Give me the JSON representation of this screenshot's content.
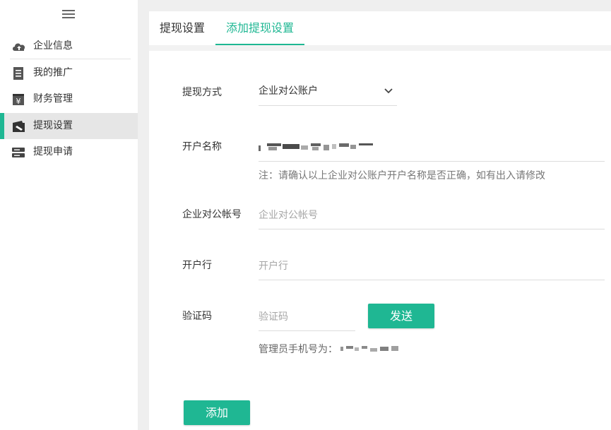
{
  "sidebar": {
    "menu_icon": "hamburger-icon",
    "items": [
      {
        "label": "企业信息",
        "icon": "cloud-upload-icon",
        "active": false
      },
      {
        "label": "我的推广",
        "icon": "document-icon",
        "active": false
      },
      {
        "label": "财务管理",
        "icon": "yen-box-icon",
        "active": false
      },
      {
        "label": "提现设置",
        "icon": "wallet-icon",
        "active": true
      },
      {
        "label": "提现申请",
        "icon": "list-stack-icon",
        "active": false
      }
    ]
  },
  "tabs": [
    {
      "label": "提现设置",
      "active": false
    },
    {
      "label": "添加提现设置",
      "active": true
    }
  ],
  "form": {
    "method": {
      "label": "提现方式",
      "value": "企业对公账户"
    },
    "account_name": {
      "label": "开户名称",
      "note": "注：请确认以上企业对公账户开户名称是否正确，如有出入请修改"
    },
    "account_number": {
      "label": "企业对公帐号",
      "placeholder": "企业对公帐号"
    },
    "bank": {
      "label": "开户行",
      "placeholder": "开户行"
    },
    "code": {
      "label": "验证码",
      "placeholder": "验证码",
      "send_label": "发送",
      "phone_prefix": "管理员手机号为："
    },
    "submit_label": "添加"
  },
  "colors": {
    "accent": "#1fb793",
    "active_bg": "#e6e6e6",
    "page_bg": "#efefef"
  }
}
